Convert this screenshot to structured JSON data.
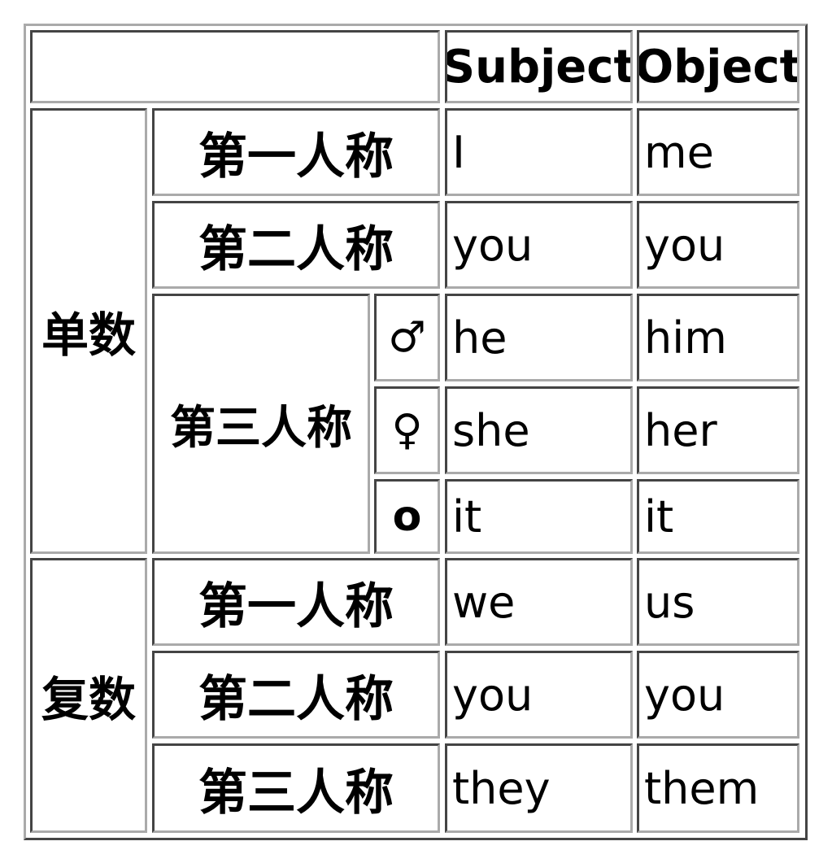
{
  "header": {
    "corner": "",
    "subject": "Subject",
    "object": "Object"
  },
  "singular": {
    "label": "单数",
    "first": {
      "person": "第一人称",
      "subject": "I",
      "object": "me"
    },
    "second": {
      "person": "第二人称",
      "subject": "you",
      "object": "you"
    },
    "third": {
      "person": "第三人称",
      "masculine": {
        "symbol": "♂",
        "subject": "he",
        "object": "him"
      },
      "feminine": {
        "symbol": "♀",
        "subject": "she",
        "object": "her"
      },
      "neuter": {
        "symbol": "o",
        "subject": "it",
        "object": "it"
      }
    }
  },
  "plural": {
    "label": "复数",
    "first": {
      "person": "第一人称",
      "subject": "we",
      "object": "us"
    },
    "second": {
      "person": "第二人称",
      "subject": "you",
      "object": "you"
    },
    "third": {
      "person": "第三人称",
      "subject": "they",
      "object": "them"
    }
  }
}
